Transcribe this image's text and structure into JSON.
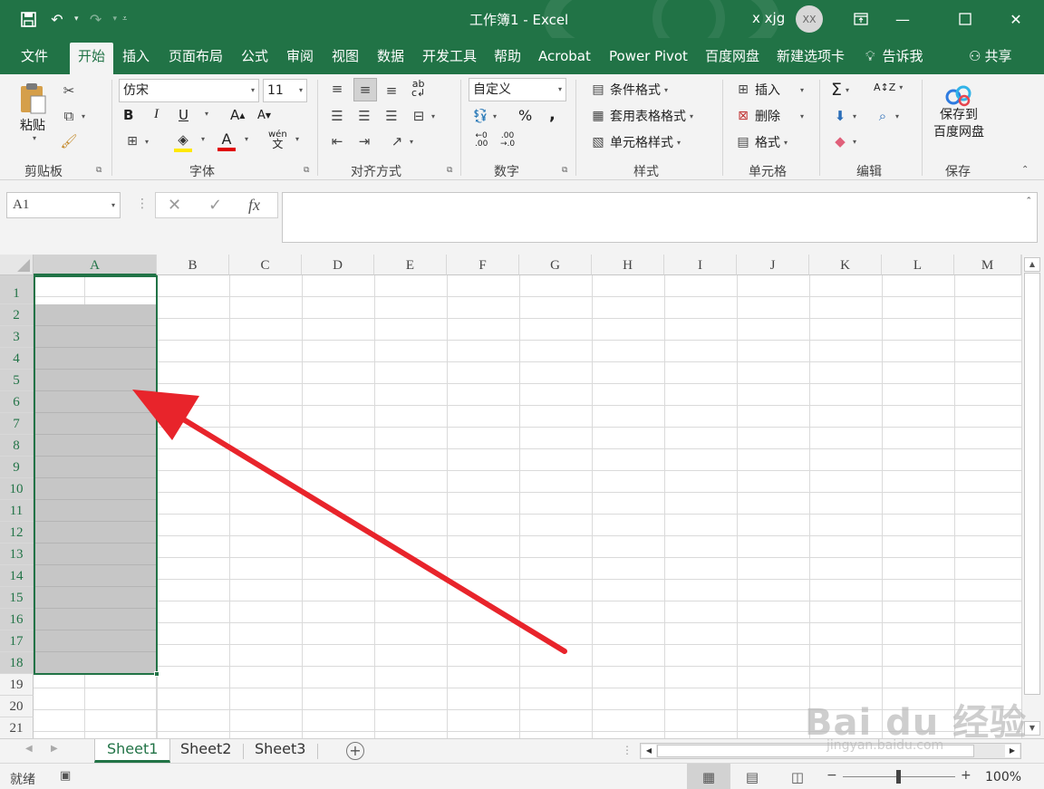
{
  "titlebar": {
    "doc_title": "工作簿1  -  Excel",
    "user_name": "x xjg",
    "avatar_initials": "XX"
  },
  "tabs": [
    "文件",
    "开始",
    "插入",
    "页面布局",
    "公式",
    "审阅",
    "视图",
    "数据",
    "开发工具",
    "帮助",
    "Acrobat",
    "Power Pivot",
    "百度网盘",
    "新建选项卡",
    "告诉我",
    "共享"
  ],
  "active_tab": "开始",
  "ribbon": {
    "clipboard": {
      "paste": "粘贴",
      "label": "剪贴板"
    },
    "font": {
      "family": "仿宋",
      "size": "11",
      "label": "字体",
      "bold": "B",
      "italic": "I",
      "underline": "U",
      "font_color_glyph": "A",
      "phonetic": "wén"
    },
    "alignment": {
      "label": "对齐方式"
    },
    "number": {
      "format": "自定义",
      "label": "数字",
      "percent": "%",
      "comma": ","
    },
    "styles": {
      "conditional": "条件格式",
      "table": "套用表格格式",
      "cell": "单元格样式",
      "label": "样式"
    },
    "cells": {
      "insert": "插入",
      "delete": "删除",
      "format": "格式",
      "label": "单元格"
    },
    "editing": {
      "label": "编辑"
    },
    "save": {
      "button": "保存到\n百度网盘",
      "label": "保存"
    }
  },
  "formula_bar": {
    "name_box": "A1",
    "fx": "fx",
    "value": ""
  },
  "columns": [
    "A",
    "B",
    "C",
    "D",
    "E",
    "F",
    "G",
    "H",
    "I",
    "J",
    "K",
    "L",
    "M"
  ],
  "selected_column": "A",
  "rows": [
    "1",
    "2",
    "3",
    "4",
    "5",
    "6",
    "7",
    "8",
    "9",
    "10",
    "11",
    "12",
    "13",
    "14",
    "15",
    "16",
    "17",
    "18",
    "19",
    "20",
    "21"
  ],
  "selection": {
    "range": "A1:A18",
    "active_cell": "A1"
  },
  "sheets": [
    "Sheet1",
    "Sheet2",
    "Sheet3"
  ],
  "active_sheet": "Sheet1",
  "status": {
    "mode": "就绪",
    "zoom": "100%"
  },
  "watermark": {
    "logo": "Bai du 经验",
    "url": "jingyan.baidu.com"
  },
  "colors": {
    "excel_green": "#217346",
    "selection_fill": "#c6c6c6",
    "annotation_arrow": "#e8242b"
  }
}
